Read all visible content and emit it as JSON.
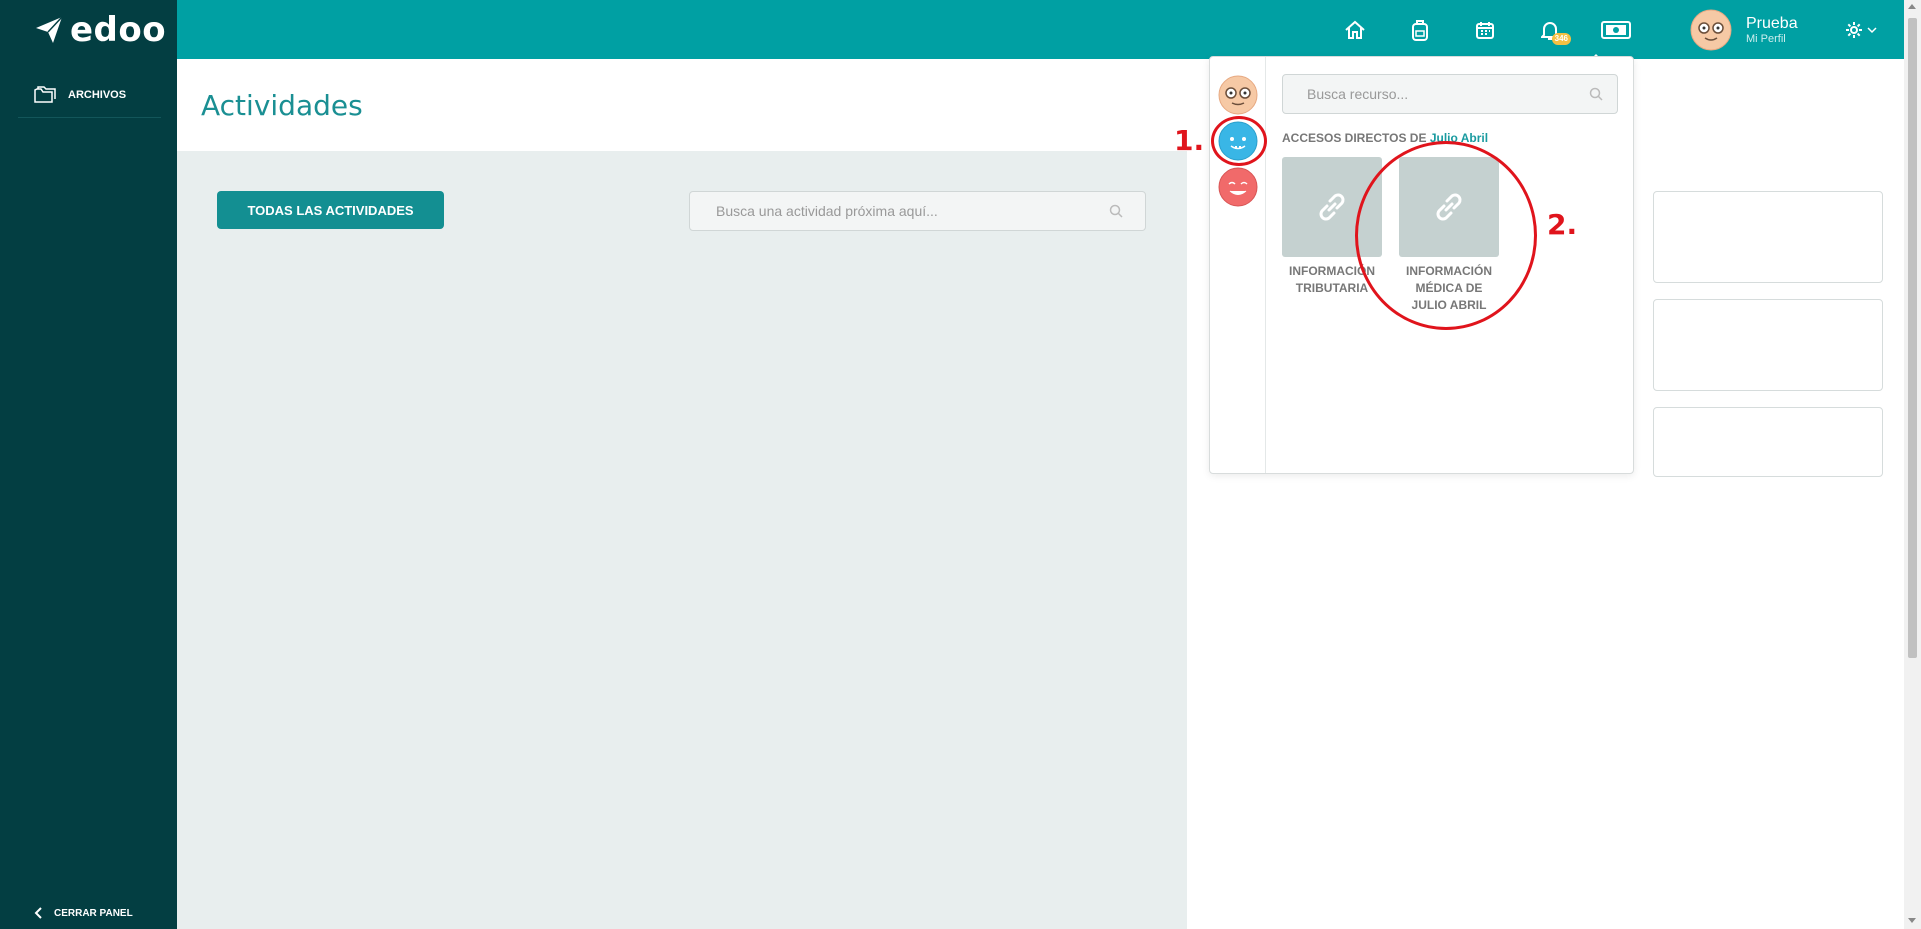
{
  "app": {
    "logo_text": "edoo"
  },
  "sidebar": {
    "items": [
      {
        "label": "ARCHIVOS",
        "icon": "folder-icon"
      }
    ],
    "footer_label": "CERRAR PANEL"
  },
  "topbar": {
    "icons": [
      "home-icon",
      "backpack-icon",
      "calendar-icon",
      "bell-icon",
      "money-icon"
    ],
    "notification_count": "346",
    "profile": {
      "name": "Prueba",
      "subtitle": "Mi Perfil"
    }
  },
  "main": {
    "title": "Actividades",
    "all_activities_button": "TODAS LAS ACTIVIDADES",
    "search_placeholder": "Busca una actividad próxima aquí..."
  },
  "dropdown": {
    "search_placeholder": "Busca recurso...",
    "shortcuts_label": "ACCESOS DIRECTOS DE",
    "shortcuts_owner": "Julio Abril",
    "resources": [
      {
        "label": "INFORMACIÓN TRIBUTARIA"
      },
      {
        "label": "INFORMACIÓN MÉDICA DE JULIO ABRIL"
      }
    ]
  },
  "annotations": {
    "step1": "1.",
    "step2": "2."
  },
  "colors": {
    "primary": "#00a0a3",
    "sidebar": "#033e42",
    "accent": "#1a9ba0",
    "annotation": "#e0141c"
  }
}
